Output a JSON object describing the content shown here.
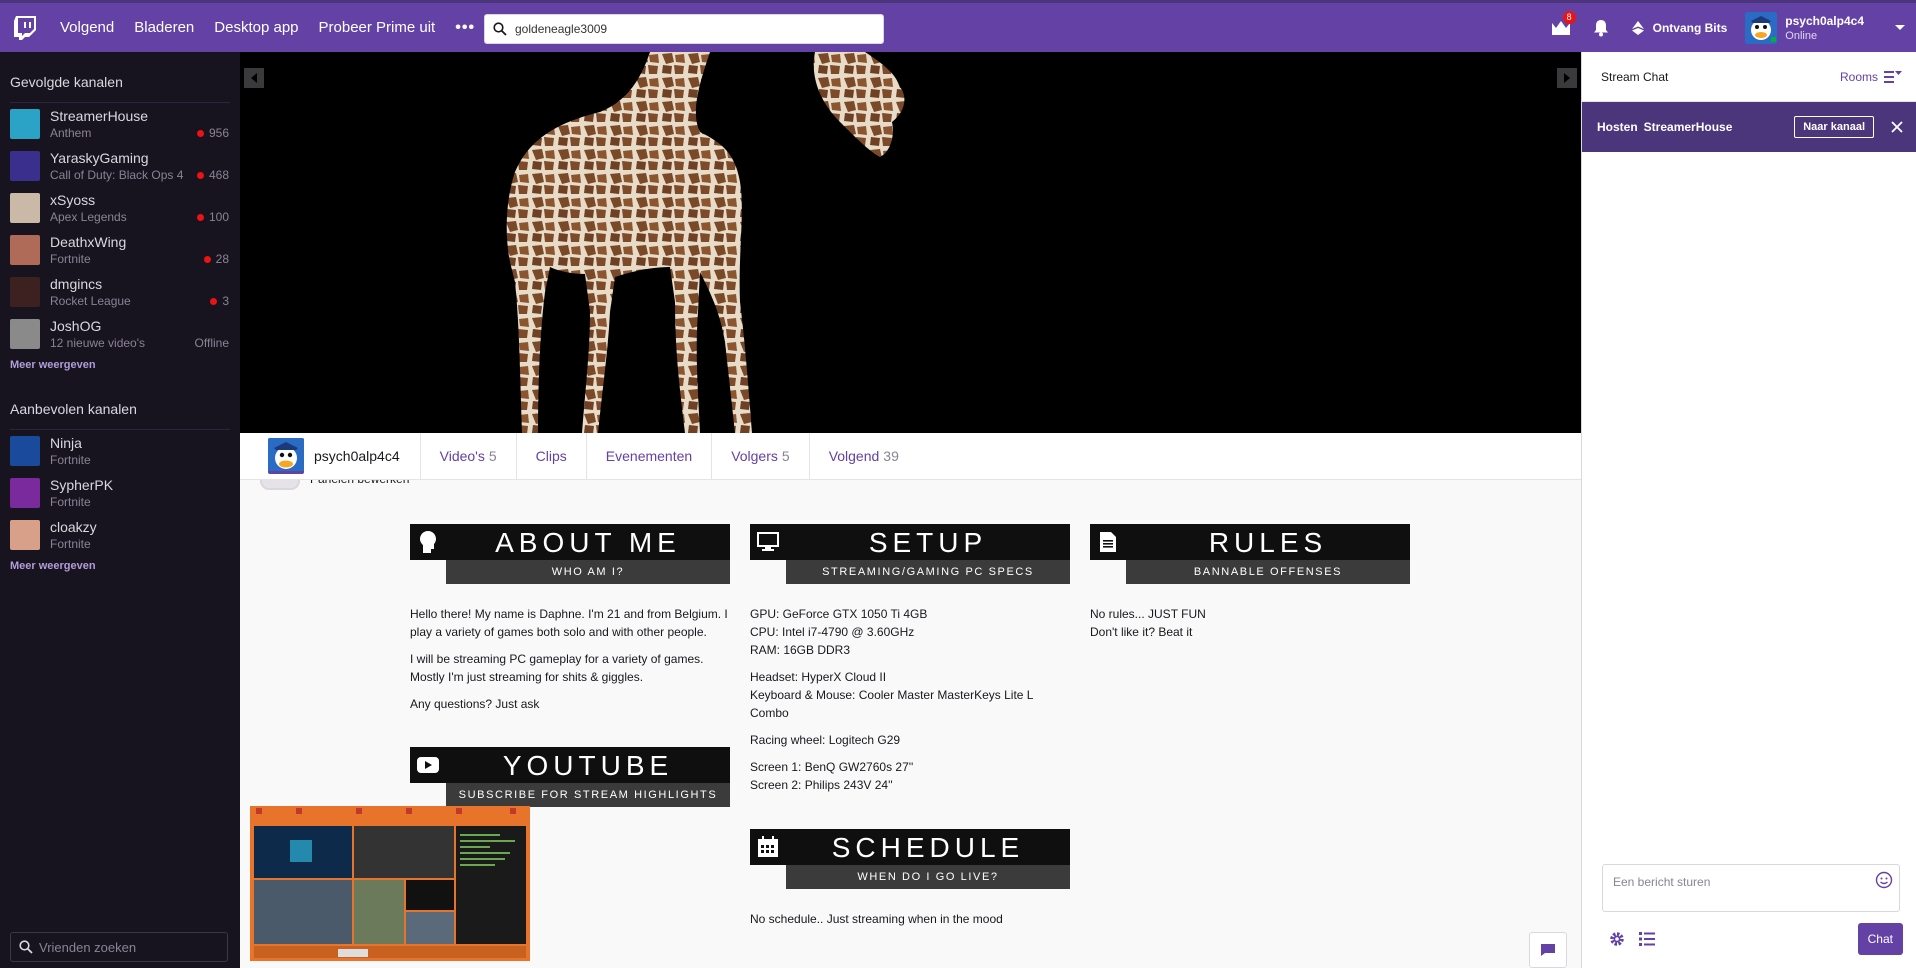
{
  "nav": {
    "links": [
      "Volgend",
      "Bladeren",
      "Desktop app",
      "Probeer Prime uit"
    ],
    "more": "•••",
    "search_value": "goldeneagle3009",
    "crown_badge": "8",
    "bits_label": "Ontvang Bits",
    "username": "psych0alp4c4",
    "status": "Online"
  },
  "sidebar": {
    "followed_title": "Gevolgde kanalen",
    "followed": [
      {
        "name": "StreamerHouse",
        "game": "Anthem",
        "viewers": "956",
        "live": true,
        "color": "#2aa3c6"
      },
      {
        "name": "YaraskyGaming",
        "game": "Call of Duty: Black Ops 4",
        "viewers": "468",
        "live": true,
        "color": "#3a2f8c"
      },
      {
        "name": "xSyoss",
        "game": "Apex Legends",
        "viewers": "100",
        "live": true,
        "color": "#c9b9a6"
      },
      {
        "name": "DeathxWing",
        "game": "Fortnite",
        "viewers": "28",
        "live": true,
        "color": "#b06a58"
      },
      {
        "name": "dmgincs",
        "game": "Rocket League",
        "viewers": "3",
        "live": true,
        "color": "#3d2020"
      },
      {
        "name": "JoshOG",
        "game": "12 nieuwe video's",
        "viewers": "Offline",
        "live": false,
        "color": "#8a8a8a"
      }
    ],
    "followed_more": "Meer weergeven",
    "recommended_title": "Aanbevolen kanalen",
    "recommended": [
      {
        "name": "Ninja",
        "game": "Fortnite",
        "color": "#1a4a9c"
      },
      {
        "name": "SypherPK",
        "game": "Fortnite",
        "color": "#7a2a9c"
      },
      {
        "name": "cloakzy",
        "game": "Fortnite",
        "color": "#d8a088"
      }
    ],
    "recommended_more": "Meer weergeven",
    "friend_search_placeholder": "Vrienden zoeken"
  },
  "channel": {
    "name": "psych0alp4c4",
    "tabs": [
      {
        "label": "Video's",
        "count": "5"
      },
      {
        "label": "Clips",
        "count": ""
      },
      {
        "label": "Evenementen",
        "count": ""
      },
      {
        "label": "Volgers",
        "count": "5"
      },
      {
        "label": "Volgend",
        "count": "39"
      }
    ],
    "edit_panels_label": "Panelen bewerken"
  },
  "panels": {
    "about": {
      "title": "ABOUT ME",
      "subtitle": "WHO AM I?",
      "paras": [
        "Hello there! My name is Daphne. I'm 21 and from Belgium. I play a variety of games both solo and with other people.",
        "I will be streaming PC gameplay for a variety of games. Mostly I'm just streaming for shits & giggles.",
        "Any questions? Just ask"
      ]
    },
    "setup": {
      "title": "SETUP",
      "subtitle": "STREAMING/GAMING PC SPECS",
      "paras": [
        "GPU: GeForce GTX 1050 Ti 4GB",
        "CPU: Intel i7-4790 @ 3.60GHz",
        "RAM: 16GB DDR3",
        "Headset: HyperX Cloud II",
        "Keyboard & Mouse: Cooler Master MasterKeys Lite L Combo",
        "Racing wheel: Logitech G29",
        "Screen 1: BenQ GW2760s 27''",
        "Screen 2: Philips 243V 24''"
      ]
    },
    "rules": {
      "title": "RULES",
      "subtitle": "BANNABLE OFFENSES",
      "paras": [
        "No rules... JUST FUN",
        "Don't like it? Beat it"
      ]
    },
    "youtube": {
      "title": "YOUTUBE",
      "subtitle": "SUBSCRIBE FOR STREAM HIGHLIGHTS"
    },
    "schedule": {
      "title": "SCHEDULE",
      "subtitle": "WHEN DO I GO LIVE?",
      "paras": [
        "No schedule.. Just streaming when in the mood"
      ]
    }
  },
  "chat": {
    "title": "Stream Chat",
    "rooms": "Rooms",
    "host_label": "Hosten",
    "host_name": "StreamerHouse",
    "host_button": "Naar kanaal",
    "input_placeholder": "Een bericht sturen",
    "send_button": "Chat"
  }
}
